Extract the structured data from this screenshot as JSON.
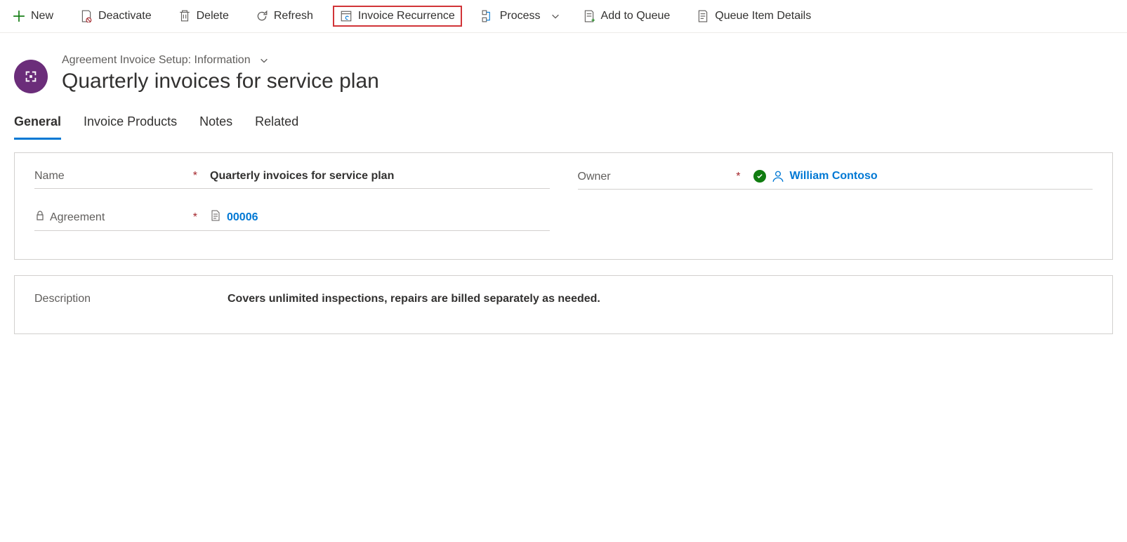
{
  "toolbar": {
    "new": "New",
    "deactivate": "Deactivate",
    "delete": "Delete",
    "refresh": "Refresh",
    "invoice_recurrence": "Invoice Recurrence",
    "process": "Process",
    "add_to_queue": "Add to Queue",
    "queue_item_details": "Queue Item Details"
  },
  "header": {
    "form_type": "Agreement Invoice Setup: Information",
    "title": "Quarterly invoices for service plan"
  },
  "tabs": {
    "general": "General",
    "invoice_products": "Invoice Products",
    "notes": "Notes",
    "related": "Related"
  },
  "fields": {
    "name_label": "Name",
    "name_value": "Quarterly invoices for service plan",
    "agreement_label": "Agreement",
    "agreement_value": "00006",
    "owner_label": "Owner",
    "owner_value": "William Contoso",
    "description_label": "Description",
    "description_value": "Covers unlimited inspections, repairs are billed separately as needed."
  }
}
